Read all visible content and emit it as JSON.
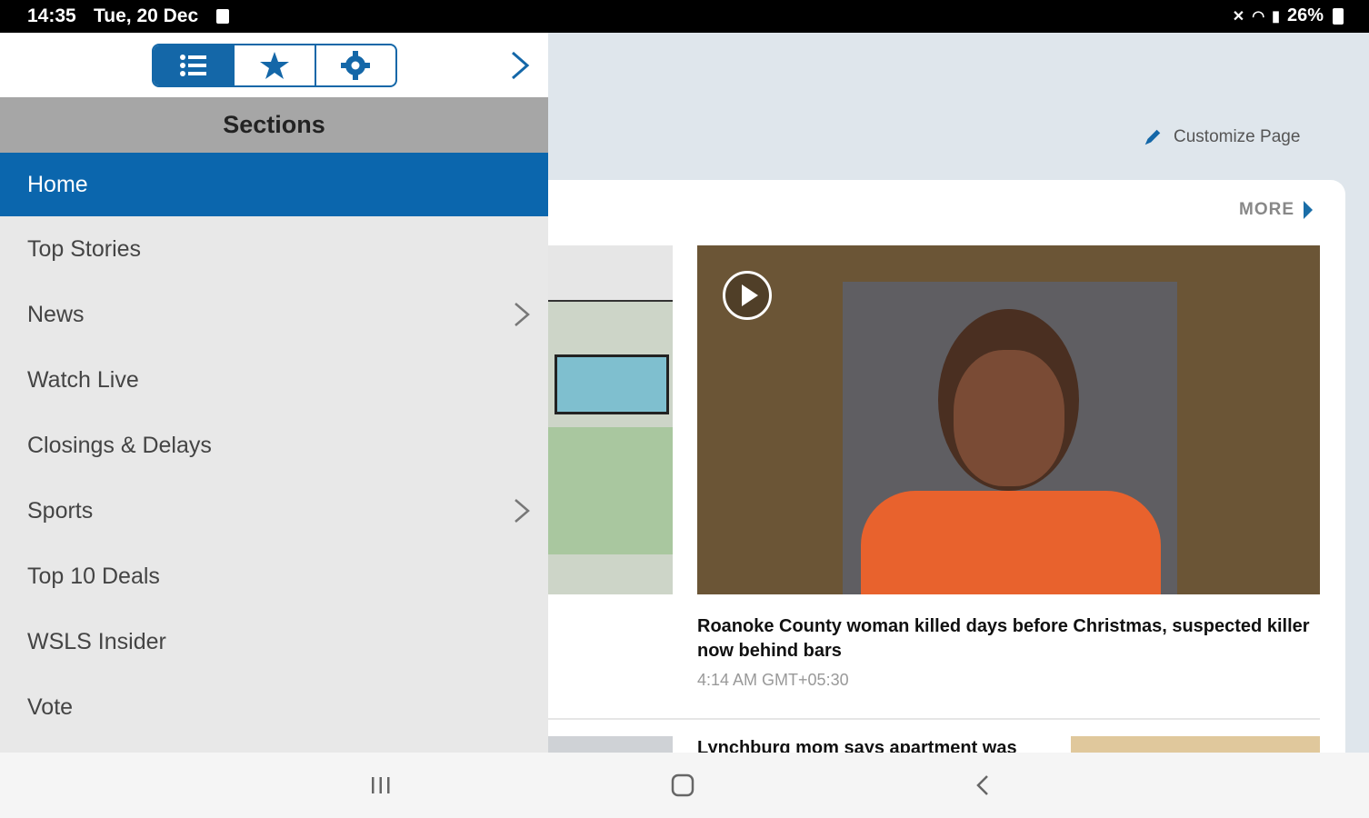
{
  "status_bar": {
    "time": "14:35",
    "date": "Tue, 20 Dec",
    "battery": "26%"
  },
  "drawer": {
    "header_title": "Sections",
    "tabs": [
      {
        "name": "sections-list",
        "icon": "list-icon",
        "active": true
      },
      {
        "name": "favorites",
        "icon": "star-icon",
        "active": false
      },
      {
        "name": "settings",
        "icon": "gear-icon",
        "active": false
      }
    ],
    "items": [
      {
        "label": "Home",
        "active": true,
        "has_submenu": false
      },
      {
        "label": "Top Stories",
        "active": false,
        "has_submenu": false
      },
      {
        "label": "News",
        "active": false,
        "has_submenu": true
      },
      {
        "label": "Watch Live",
        "active": false,
        "has_submenu": false
      },
      {
        "label": "Closings & Delays",
        "active": false,
        "has_submenu": false
      },
      {
        "label": "Sports",
        "active": false,
        "has_submenu": true
      },
      {
        "label": "Top 10 Deals",
        "active": false,
        "has_submenu": false
      },
      {
        "label": "WSLS Insider",
        "active": false,
        "has_submenu": false
      },
      {
        "label": "Vote",
        "active": false,
        "has_submenu": false
      }
    ]
  },
  "main": {
    "customize_label": "Customize Page",
    "more_label": "MORE",
    "headline": "Roanoke County woman killed days before Christmas, suspected killer now behind bars",
    "timestamp": "4:14 AM GMT+05:30",
    "headline_partial": "Lynchburg mom says apartment was"
  },
  "colors": {
    "accent": "#0b66ad",
    "drawer_bg": "#e8e8e8",
    "section_header_bg": "#a6a6a6"
  }
}
